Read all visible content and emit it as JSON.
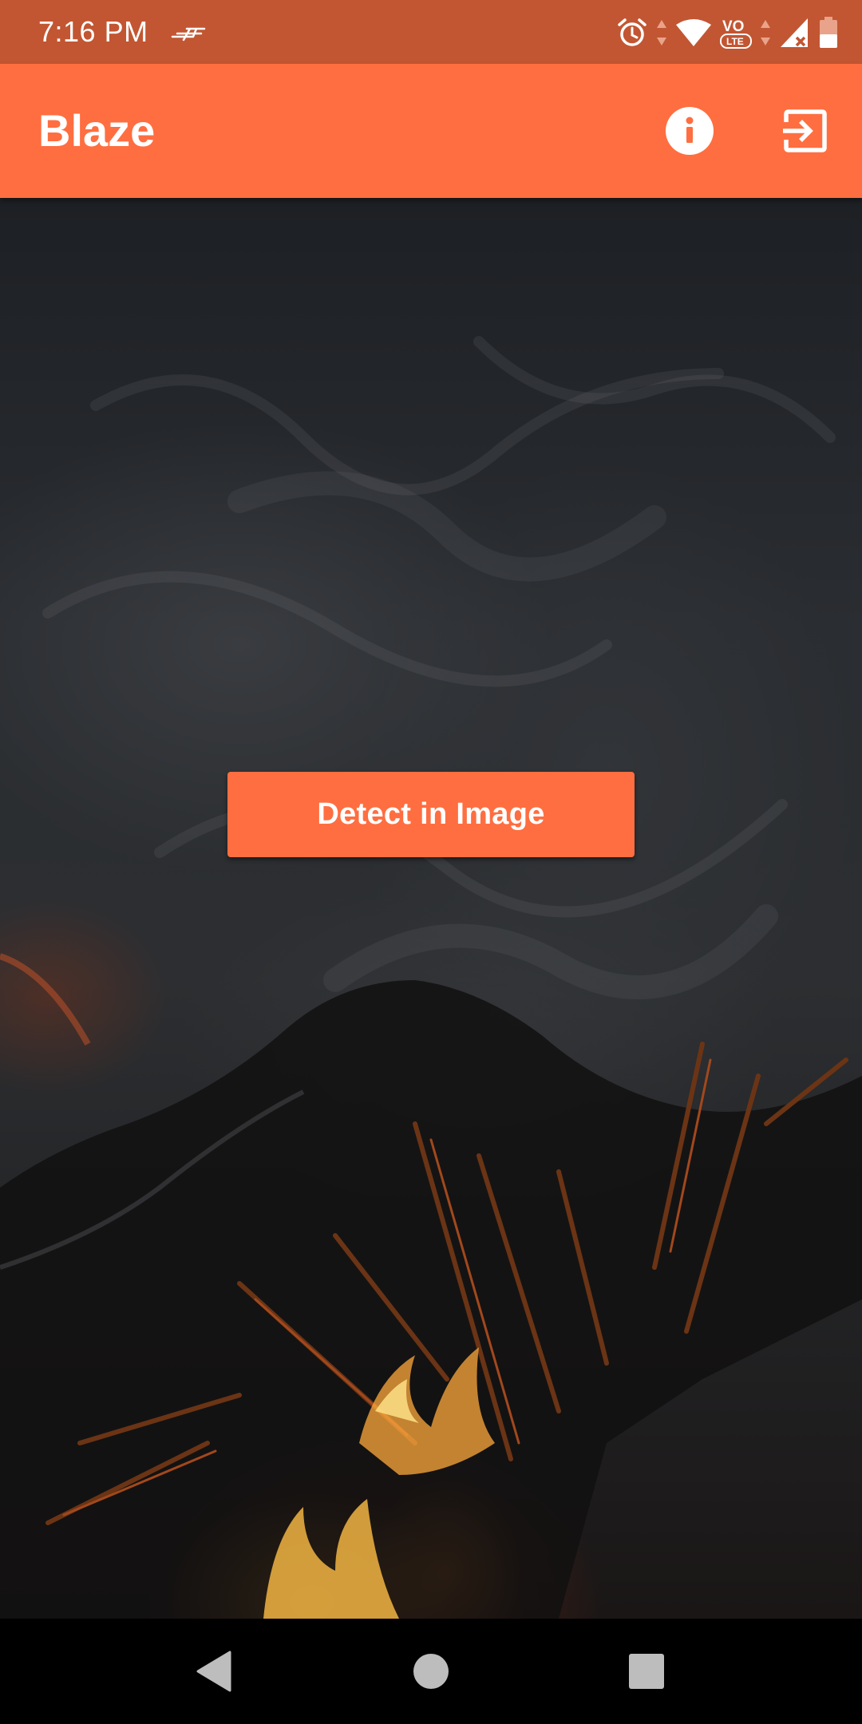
{
  "status_bar": {
    "time": "7:16 PM",
    "icons": [
      "notification-icon",
      "alarm-icon",
      "data-arrows-icon",
      "wifi-icon",
      "volte-icon",
      "signal-icon",
      "battery-icon"
    ]
  },
  "app_bar": {
    "title": "Blaze",
    "actions": [
      "info-icon",
      "exit-icon"
    ]
  },
  "main": {
    "detect_button_label": "Detect in Image"
  },
  "nav_bar": {
    "buttons": [
      "back-icon",
      "home-icon",
      "recents-icon"
    ]
  },
  "colors": {
    "accent": "#ff6e40",
    "status_bar": "#c25632",
    "nav_bar": "#000000"
  }
}
